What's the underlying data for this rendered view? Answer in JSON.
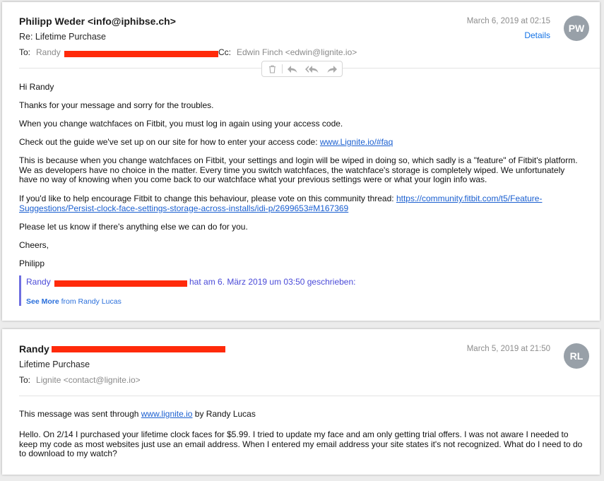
{
  "email1": {
    "from": "Philipp Weder <info@iphibse.ch>",
    "subject": "Re: Lifetime Purchase",
    "to_label": "To:",
    "to_name": "Randy",
    "cc_label": "Cc:",
    "cc_value": "Edwin Finch <edwin@lignite.io>",
    "date": "March 6, 2019 at 02:15",
    "details": "Details",
    "avatar_initials": "PW",
    "body": {
      "greeting": "Hi Randy",
      "p1": "Thanks for your message and sorry for the troubles.",
      "p2": "When you change watchfaces on Fitbit, you must log in again using your access code.",
      "p3_text": "Check out the guide we've set up on our site for how to enter your access code: ",
      "p3_link": "www.Lignite.io/#faq",
      "p4": "This is because when you change watchfaces on Fitbit, your settings and login will be wiped in doing so, which sadly is a \"feature\" of Fitbit's platform. We as developers have no choice in the matter. Every time you switch watchfaces, the watchface's storage is completely wiped. We unfortunately have no way of knowing when you come back to our watchface what your previous settings were or what your login info was.",
      "p5_text": "If you'd like to help encourage Fitbit to change this behaviour, please vote on this community thread: ",
      "p5_link": "https://community.fitbit.com/t5/Feature-Suggestions/Persist-clock-face-settings-storage-across-installs/idi-p/2699653#M167369",
      "p6": "Please let us know if there's anything else we can do for you.",
      "closing": "Cheers,",
      "signature": "Philipp"
    },
    "quote": {
      "prefix": "Randy",
      "suffix": "hat am 6. März 2019 um 03:50 geschrieben:",
      "see_more": "See More",
      "see_more_from": "from Randy Lucas"
    }
  },
  "toolbar": {
    "icons": [
      "trash-icon",
      "reply-icon",
      "reply-all-icon",
      "forward-icon"
    ]
  },
  "email2": {
    "from": "Randy",
    "subject": "Lifetime Purchase",
    "to_label": "To:",
    "to_value": "Lignite <contact@lignite.io>",
    "date": "March 5, 2019 at 21:50",
    "avatar_initials": "RL",
    "body": {
      "p1_text": "This message was sent through ",
      "p1_link": "www.lignite.io",
      "p1_suffix": " by Randy Lucas",
      "p2": "Hello. On 2/14 I purchased your lifetime clock faces for $5.99. I tried to update my face and am only getting trial offers. I was not aware I needed to keep my code as most websites just use an email address. When I entered my email address your site states it's not recognized. What do I need to do to download to my watch?"
    }
  },
  "colors": {
    "redaction": "#ff2a0a",
    "link": "#1a5fd0",
    "avatar": "#98a0a8",
    "quote_bar": "#6e6ee0"
  }
}
